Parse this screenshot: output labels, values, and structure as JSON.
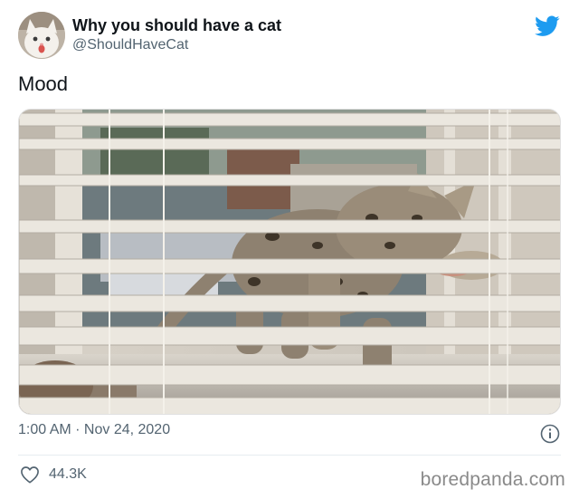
{
  "author": {
    "name": "Why you should have a cat",
    "handle": "@ShouldHaveCat"
  },
  "tweet": {
    "text": "Mood",
    "timestamp": "1:00 AM · Nov 24, 2020",
    "like_count": "44.3K"
  },
  "watermark": "boredpanda.com",
  "colors": {
    "twitter_blue": "#1d9bf0",
    "secondary_text": "#536471"
  },
  "icons": [
    "twitter-bird-icon",
    "info-icon",
    "heart-icon"
  ]
}
